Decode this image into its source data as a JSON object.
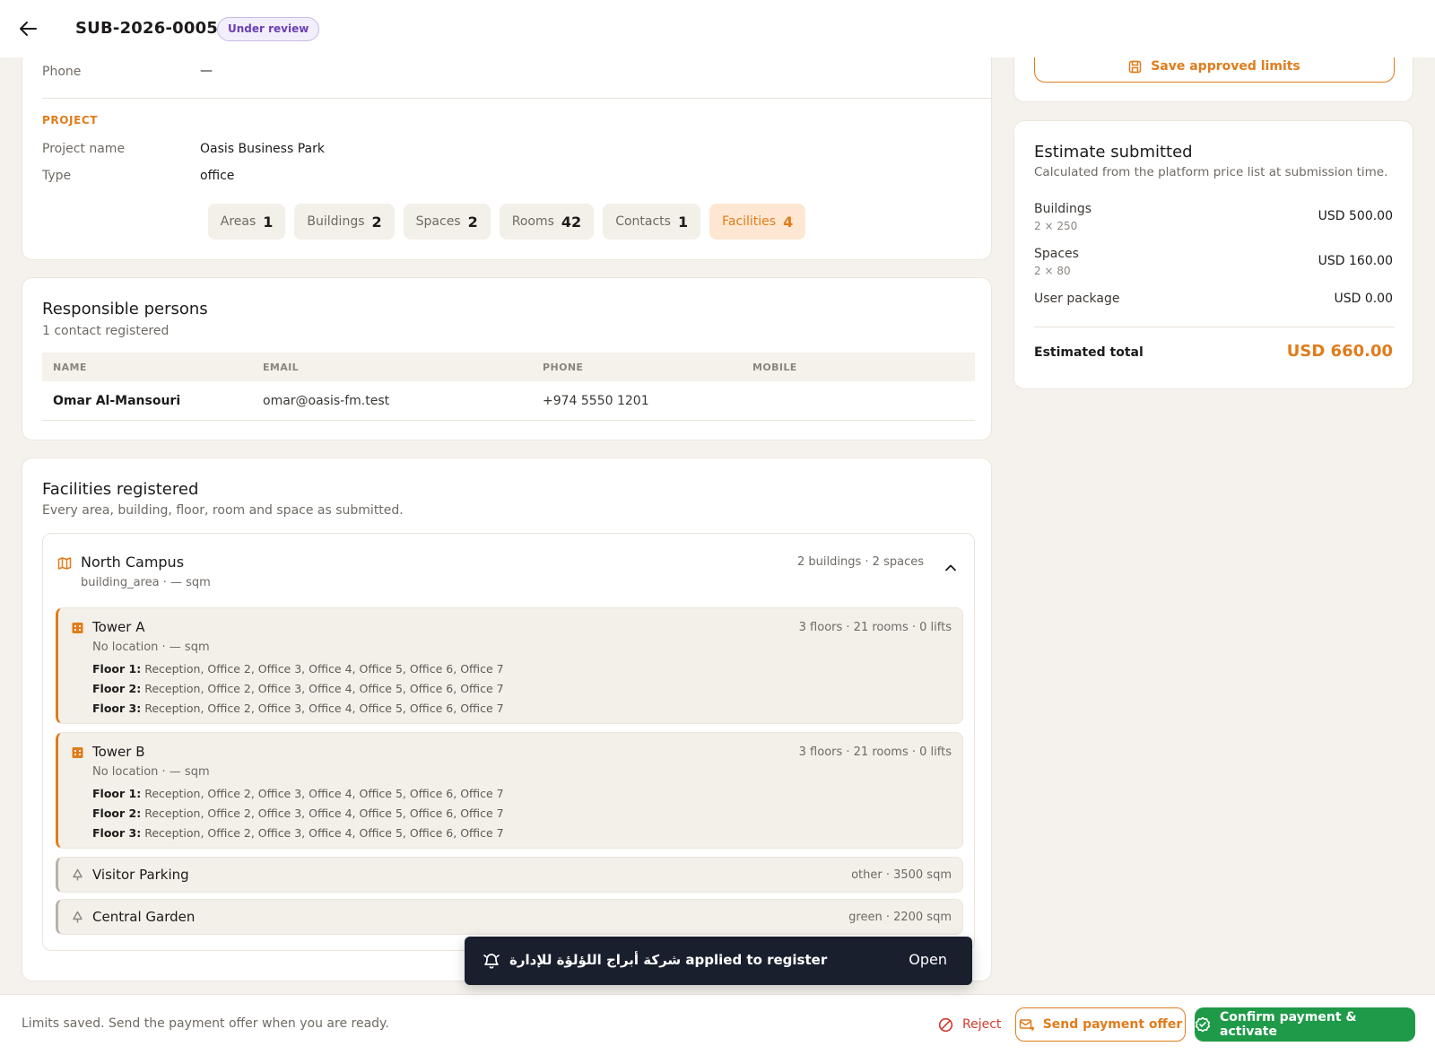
{
  "header": {
    "id": "SUB-2026-0005",
    "status": "Under review"
  },
  "contact_info": {
    "phone_label": "Phone",
    "phone_value": "—"
  },
  "project": {
    "section_label": "PROJECT",
    "name_label": "Project name",
    "name_value": "Oasis Business Park",
    "type_label": "Type",
    "type_value": "office",
    "chips": [
      {
        "label": "Areas",
        "count": "1"
      },
      {
        "label": "Buildings",
        "count": "2"
      },
      {
        "label": "Spaces",
        "count": "2"
      },
      {
        "label": "Rooms",
        "count": "42"
      },
      {
        "label": "Contacts",
        "count": "1"
      },
      {
        "label": "Facilities",
        "count": "4"
      }
    ]
  },
  "persons": {
    "title": "Responsible persons",
    "subtitle": "1 contact registered",
    "columns": [
      "NAME",
      "EMAIL",
      "PHONE",
      "MOBILE"
    ],
    "rows": [
      {
        "name": "Omar Al-Mansouri",
        "email": "omar@oasis-fm.test",
        "phone": "+974 5550 1201",
        "mobile": ""
      }
    ]
  },
  "facilities": {
    "title": "Facilities registered",
    "subtitle": "Every area, building, floor, room and space as submitted.",
    "area": {
      "name": "North Campus",
      "sub": "building_area · — sqm",
      "meta": "2 buildings · 2 spaces"
    },
    "buildings": [
      {
        "name": "Tower A",
        "meta": "3 floors · 21 rooms · 0 lifts",
        "sub": "No location · — sqm",
        "floors": [
          {
            "label": "Floor 1:",
            "rooms": "Reception, Office 2, Office 3, Office 4, Office 5, Office 6, Office 7"
          },
          {
            "label": "Floor 2:",
            "rooms": "Reception, Office 2, Office 3, Office 4, Office 5, Office 6, Office 7"
          },
          {
            "label": "Floor 3:",
            "rooms": "Reception, Office 2, Office 3, Office 4, Office 5, Office 6, Office 7"
          }
        ]
      },
      {
        "name": "Tower B",
        "meta": "3 floors · 21 rooms · 0 lifts",
        "sub": "No location · — sqm",
        "floors": [
          {
            "label": "Floor 1:",
            "rooms": "Reception, Office 2, Office 3, Office 4, Office 5, Office 6, Office 7"
          },
          {
            "label": "Floor 2:",
            "rooms": "Reception, Office 2, Office 3, Office 4, Office 5, Office 6, Office 7"
          },
          {
            "label": "Floor 3:",
            "rooms": "Reception, Office 2, Office 3, Office 4, Office 5, Office 6, Office 7"
          }
        ]
      }
    ],
    "spaces": [
      {
        "name": "Visitor Parking",
        "meta": "other · 3500 sqm"
      },
      {
        "name": "Central Garden",
        "meta": "green · 2200 sqm"
      }
    ]
  },
  "limits": {
    "save_label": "Save approved limits"
  },
  "estimate": {
    "title": "Estimate submitted",
    "subtitle": "Calculated from the platform price list at submission time.",
    "rows": [
      {
        "label": "Buildings",
        "detail": "2 × 250",
        "value": "USD 500.00"
      },
      {
        "label": "Spaces",
        "detail": "2 × 80",
        "value": "USD 160.00"
      },
      {
        "label": "User package",
        "detail": "",
        "value": "USD 0.00"
      }
    ],
    "total_label": "Estimated total",
    "total_value": "USD 660.00"
  },
  "toast": {
    "text": "شركة أبراج اللؤلؤة للإدارة applied to register",
    "action": "Open"
  },
  "footer": {
    "status": "Limits saved. Send the payment offer when you are ready.",
    "reject_label": "Reject",
    "offer_label": "Send payment offer",
    "confirm_label": "Confirm payment & activate"
  },
  "colors": {
    "accent": "#e07c1b",
    "success": "#1e9a48",
    "danger": "#d13b2f",
    "review": "#6a3fb5"
  }
}
